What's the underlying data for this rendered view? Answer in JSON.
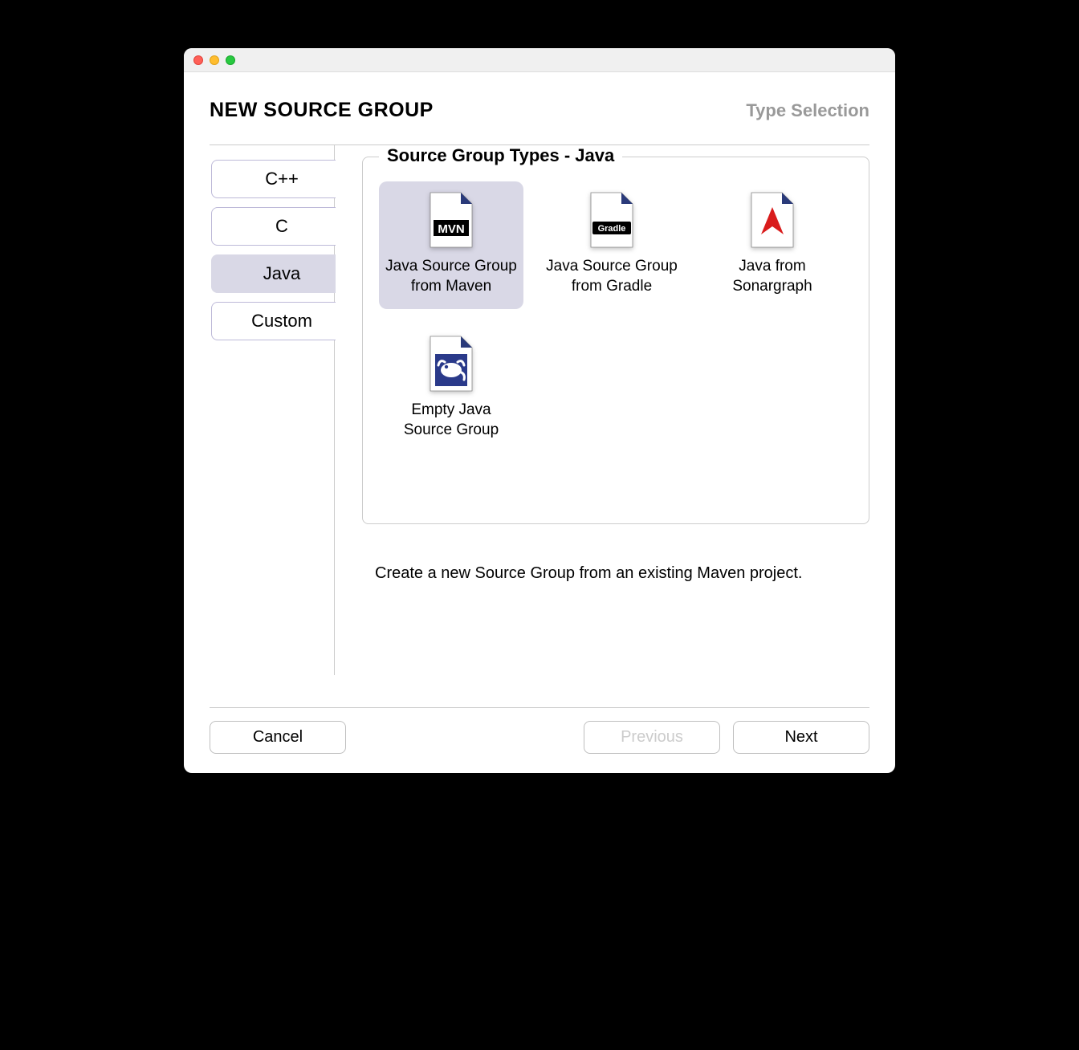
{
  "header": {
    "title": "NEW SOURCE GROUP",
    "subtitle": "Type Selection"
  },
  "sidebar": {
    "items": [
      {
        "label": "C++",
        "selected": false
      },
      {
        "label": "C",
        "selected": false
      },
      {
        "label": "Java",
        "selected": true
      },
      {
        "label": "Custom",
        "selected": false
      }
    ]
  },
  "types": {
    "legend": "Source Group Types - Java",
    "items": [
      {
        "label": "Java Source Group from Maven",
        "icon": "mvn",
        "selected": true
      },
      {
        "label": "Java Source Group from Gradle",
        "icon": "gradle",
        "selected": false
      },
      {
        "label": "Java from Sonargraph",
        "icon": "sonargraph",
        "selected": false
      },
      {
        "label": "Empty Java Source Group",
        "icon": "sourcetrail",
        "selected": false
      }
    ]
  },
  "description": "Create a new Source Group from an existing Maven project.",
  "footer": {
    "cancel": "Cancel",
    "previous": "Previous",
    "next": "Next"
  },
  "icons": {
    "mvn_text": "MVN",
    "gradle_text": "Gradle"
  }
}
